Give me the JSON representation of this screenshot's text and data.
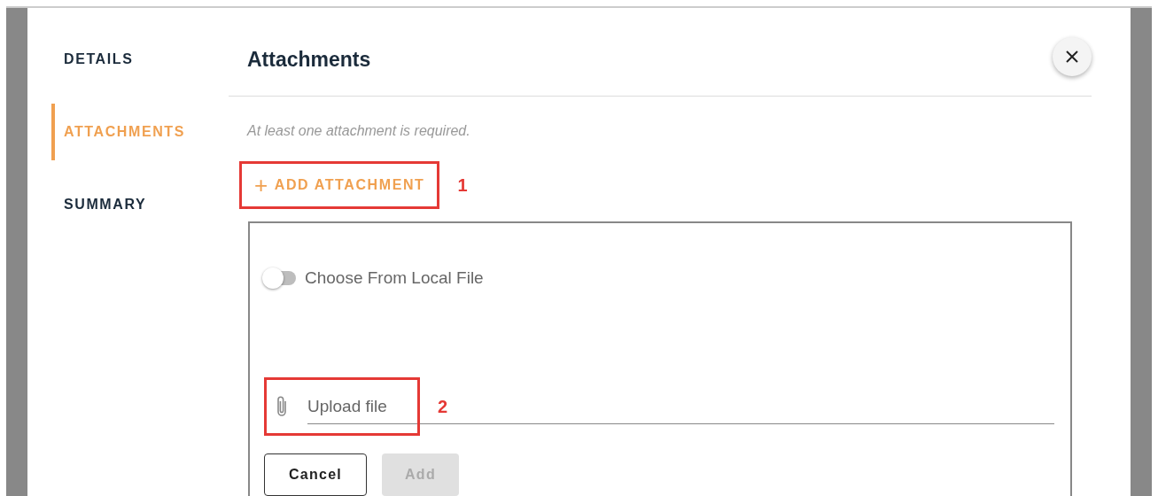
{
  "nav": [
    {
      "label": "DETAILS",
      "selected": false
    },
    {
      "label": "ATTACHMENTS",
      "selected": true
    },
    {
      "label": "SUMMARY",
      "selected": false
    }
  ],
  "header": {
    "title": "Attachments"
  },
  "hint": "At least one attachment is required.",
  "add_attachment": {
    "icon": "+",
    "label": "ADD ATTACHMENT",
    "annotation": "1"
  },
  "form": {
    "toggle": {
      "label": "Choose From Local File",
      "on": false
    },
    "upload": {
      "placeholder": "Upload file",
      "annotation": "2"
    },
    "buttons": [
      {
        "label": "Cancel",
        "kind": "outline",
        "disabled": false
      },
      {
        "label": "Add",
        "kind": "filled",
        "disabled": true
      }
    ]
  }
}
